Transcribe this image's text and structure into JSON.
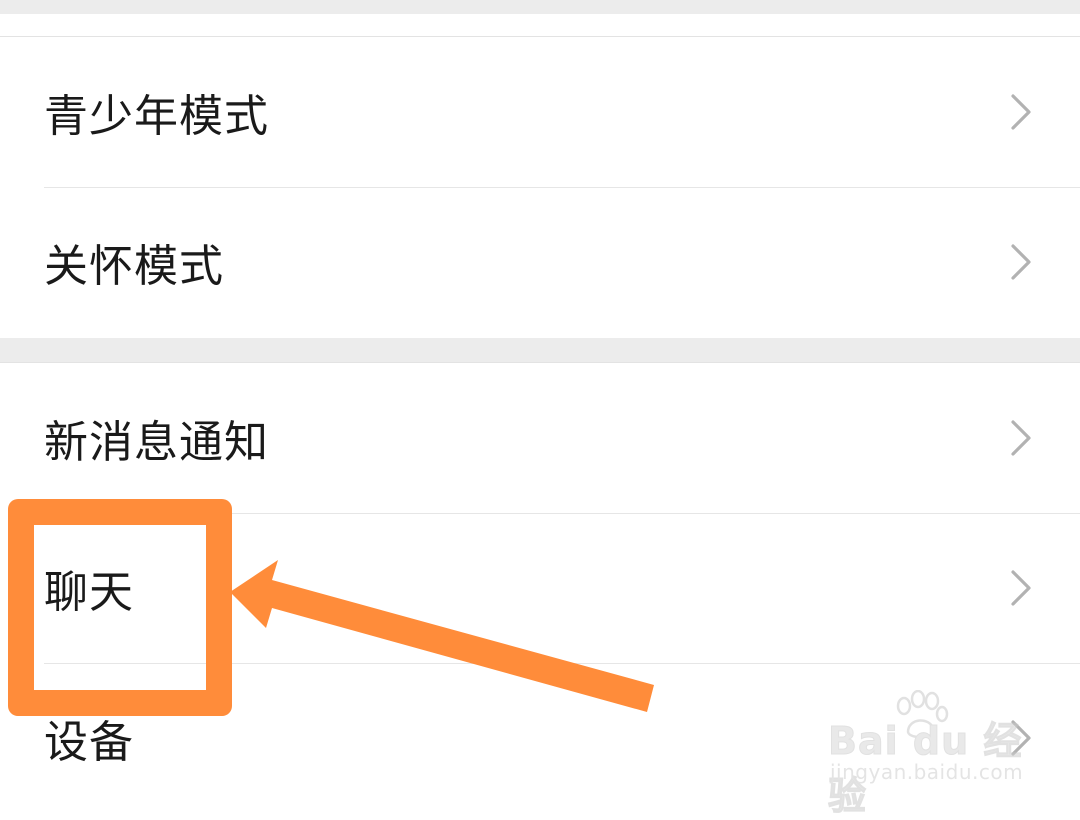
{
  "settings": {
    "group1": [
      {
        "label": "青少年模式"
      },
      {
        "label": "关怀模式"
      }
    ],
    "group2": [
      {
        "label": "新消息通知"
      },
      {
        "label": "聊天"
      },
      {
        "label": "设备"
      }
    ]
  },
  "annotation": {
    "color": "#ff8c3a",
    "highlighted_item": "聊天"
  },
  "watermark": {
    "logo_text": "Bai du 经验",
    "url": "jingyan.baidu.com"
  },
  "icons": {
    "row_chevron": "chevron-right-icon",
    "watermark_logo": "baidu-paw-icon"
  }
}
